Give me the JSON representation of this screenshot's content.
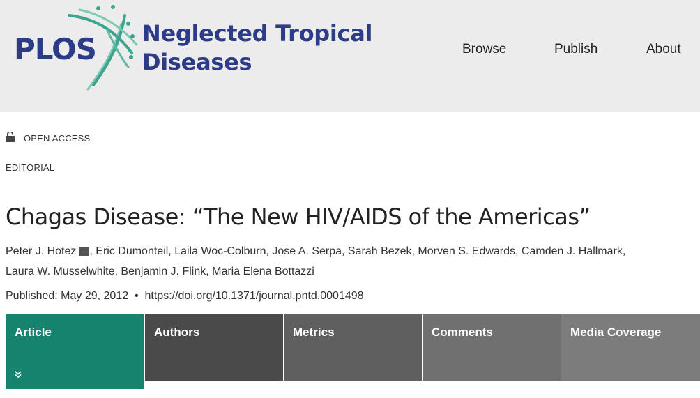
{
  "header": {
    "logo_text": "PLOS",
    "journal_name": "Neglected Tropical Diseases",
    "nav": [
      "Browse",
      "Publish",
      "About"
    ]
  },
  "article": {
    "access": "OPEN ACCESS",
    "type": "EDITORIAL",
    "title": "Chagas Disease: “The New HIV/AIDS of the Americas”",
    "authors": [
      "Peter J. Hotez",
      "Eric Dumonteil",
      "Laila Woc-Colburn",
      "Jose A. Serpa",
      "Sarah Bezek",
      "Morven S. Edwards",
      "Camden J. Hallmark",
      "Laura W. Musselwhite",
      "Benjamin J. Flink",
      "Maria Elena Bottazzi"
    ],
    "published_label": "Published:",
    "published_date": "May 29, 2012",
    "separator": "•",
    "doi": "https://doi.org/10.1371/journal.pntd.0001498"
  },
  "tabs": [
    "Article",
    "Authors",
    "Metrics",
    "Comments",
    "Media Coverage"
  ],
  "colors": {
    "header_bg": "#ececec",
    "brand_blue": "#2d3c86",
    "brand_green": "#3aa48d",
    "tab_active": "#16836f"
  },
  "icons": [
    "open-lock-icon",
    "mail-icon",
    "double-chevron-down-icon"
  ]
}
